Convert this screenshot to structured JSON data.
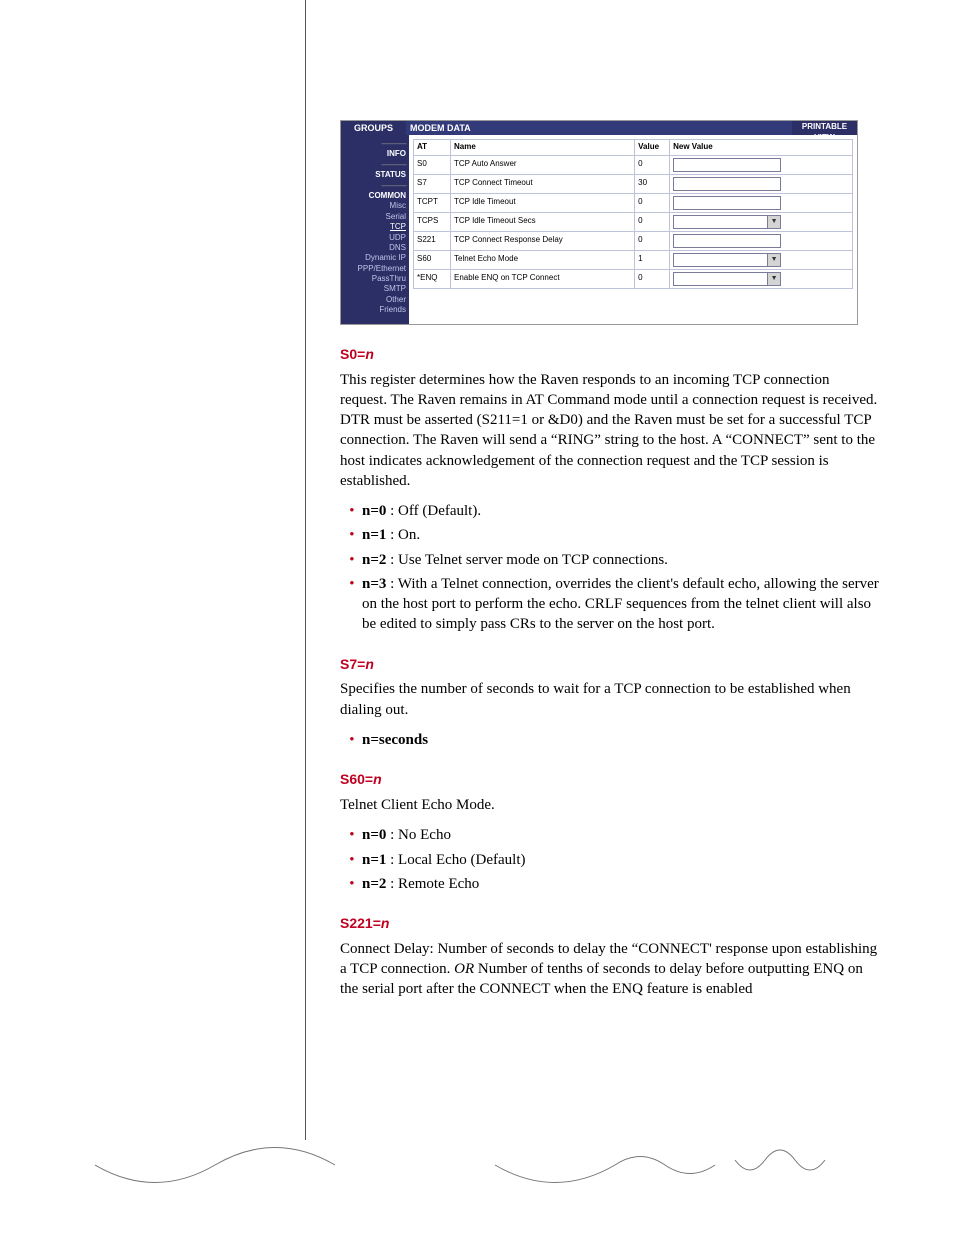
{
  "figure": {
    "topbar": {
      "groups": "GROUPS",
      "modem_data": "MODEM DATA",
      "printable": "PRINTABLE VIEW"
    },
    "sidebar": {
      "sep": "---------------",
      "info": "INFO",
      "status": "STATUS",
      "common": "COMMON",
      "items": [
        "Misc",
        "Serial",
        "TCP",
        "UDP",
        "DNS",
        "Dynamic IP",
        "PPP/Ethernet",
        "PassThru",
        "SMTP",
        "Other",
        "Friends"
      ]
    },
    "table": {
      "headers": {
        "at": "AT",
        "name": "Name",
        "value": "Value",
        "newv": "New Value"
      },
      "rows": [
        {
          "at": "S0",
          "name": "TCP Auto Answer",
          "value": "0",
          "ctl": "input"
        },
        {
          "at": "S7",
          "name": "TCP Connect Timeout",
          "value": "30",
          "ctl": "input"
        },
        {
          "at": "TCPT",
          "name": "TCP Idle Timeout",
          "value": "0",
          "ctl": "input"
        },
        {
          "at": "TCPS",
          "name": "TCP Idle Timeout Secs",
          "value": "0",
          "ctl": "select"
        },
        {
          "at": "S221",
          "name": "TCP Connect Response Delay",
          "value": "0",
          "ctl": "input"
        },
        {
          "at": "S60",
          "name": "Telnet Echo Mode",
          "value": "1",
          "ctl": "select"
        },
        {
          "at": "*ENQ",
          "name": "Enable ENQ on TCP Connect",
          "value": "0",
          "ctl": "select"
        }
      ]
    }
  },
  "sections": {
    "s0": {
      "head_plain": "S0=",
      "head_ital": "n",
      "para": "This register determines how the Raven responds to an incoming TCP connection request. The Raven remains in AT Command mode until a connection request is received. DTR must be asserted (S211=1 or &D0) and the Raven must be set for a successful TCP connection. The Raven will send a “RING” string to the host. A “CONNECT” sent to the host indicates acknowledgement of the connection request and the TCP session is established.",
      "items": [
        {
          "b": "n=0",
          "rest": " : Off (Default)."
        },
        {
          "b": "n=1",
          "rest": " : On."
        },
        {
          "b": "n=2",
          "rest": " : Use Telnet server mode on TCP connections."
        },
        {
          "b": "n=3",
          "rest": " : With a Telnet connection, overrides the client's default echo, allowing the server on the host port to perform the echo. CRLF sequences from the telnet client will also be edited to simply pass CRs to the server on the host port."
        }
      ]
    },
    "s7": {
      "head_plain": "S7=",
      "head_ital": "n",
      "para": "Specifies the number of seconds to wait for a TCP connection to be established when dialing out.",
      "items": [
        {
          "b": "n=seconds",
          "rest": ""
        }
      ]
    },
    "s60": {
      "head_plain": "S60=",
      "head_ital": "n",
      "para": "Telnet Client Echo Mode.",
      "items": [
        {
          "b": "n=0",
          "rest": " : No Echo"
        },
        {
          "b": "n=1",
          "rest": " : Local Echo (Default)"
        },
        {
          "b": "n=2",
          "rest": " : Remote Echo"
        }
      ]
    },
    "s221": {
      "head_plain": "S221=",
      "head_ital": "n",
      "para_before": "Connect Delay: Number of seconds to delay the “CONNECT' response upon establishing a TCP connection. ",
      "para_or": "OR",
      "para_after": " Number of tenths of seconds to delay before outputting ENQ on the serial port after the CONNECT when the ENQ feature is enabled"
    }
  }
}
